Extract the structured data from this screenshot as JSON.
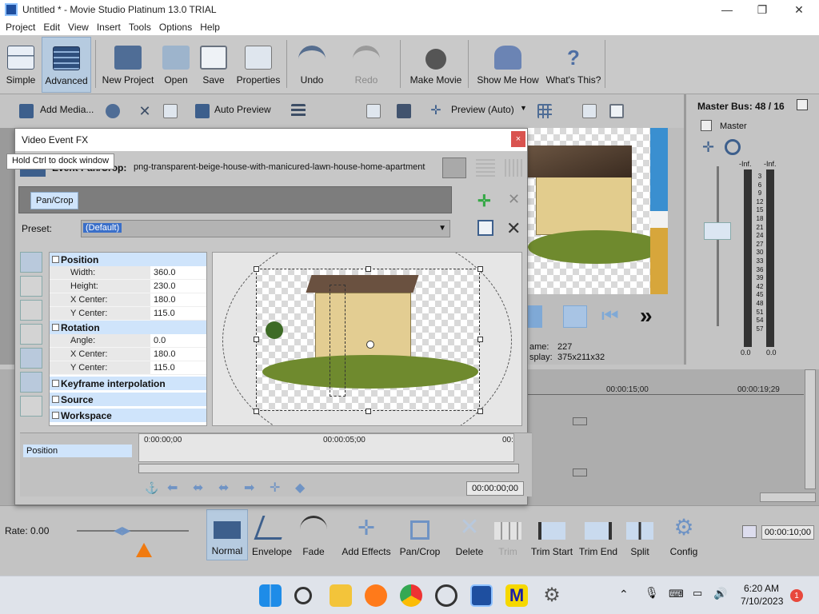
{
  "window": {
    "title": "Untitled * - Movie Studio Platinum 13.0 TRIAL"
  },
  "menu": [
    "Project",
    "Edit",
    "View",
    "Insert",
    "Tools",
    "Options",
    "Help"
  ],
  "toolbar": {
    "simple": "Simple",
    "advanced": "Advanced",
    "new_project": "New Project",
    "open": "Open",
    "save": "Save",
    "properties": "Properties",
    "undo": "Undo",
    "redo": "Redo",
    "make_movie": "Make Movie",
    "show_me_how": "Show Me How",
    "whats_this": "What's This?"
  },
  "secondary_toolbar": {
    "add_media": "Add Media...",
    "auto_preview": "Auto Preview",
    "preview_mode": "Preview (Auto)"
  },
  "mixer": {
    "title": "Master Bus: 48 / 16",
    "channel": "Master",
    "left_label": "-Inf.",
    "right_label": "-Inf.",
    "scale": [
      "3",
      "6",
      "9",
      "12",
      "15",
      "18",
      "21",
      "24",
      "27",
      "30",
      "33",
      "36",
      "39",
      "42",
      "45",
      "48",
      "51",
      "54",
      "57"
    ],
    "left_value": "0.0",
    "right_value": "0.0"
  },
  "preview_info": {
    "frame_label": "ame:",
    "frame_value": "227",
    "display_label": "splay:",
    "display_value": "375x211x32"
  },
  "dialog": {
    "title": "Video Event FX",
    "close": "×",
    "tooltip": "Hold Ctrl to dock window",
    "event_label": "Event Pan/Crop:",
    "event_value": "png-transparent-beige-house-with-manicured-lawn-house-home-apartment",
    "chain_item": "Pan/Crop",
    "preset_label": "Preset:",
    "preset_value": "(Default)",
    "props": {
      "position": {
        "title": "Position",
        "width_label": "Width:",
        "width": "360.0",
        "height_label": "Height:",
        "height": "230.0",
        "xc_label": "X Center:",
        "xc": "180.0",
        "yc_label": "Y Center:",
        "yc": "115.0"
      },
      "rotation": {
        "title": "Rotation",
        "angle_label": "Angle:",
        "angle": "0.0",
        "xc_label": "X Center:",
        "xc": "180.0",
        "yc_label": "Y Center:",
        "yc": "115.0"
      },
      "keyframe": "Keyframe interpolation",
      "source": "Source",
      "workspace": "Workspace"
    },
    "keyframe_track": "Position",
    "ruler": [
      "0:00:00;00",
      "00:00:05;00",
      "00:"
    ],
    "timecode": "00:00:00;00"
  },
  "timeline": {
    "ruler": [
      "00:00:15;00",
      "00:00:19;29"
    ]
  },
  "bottom": {
    "rate": "Rate: 0.00",
    "normal": "Normal",
    "envelope": "Envelope",
    "fade": "Fade",
    "add_effects": "Add Effects",
    "pan_crop": "Pan/Crop",
    "delete": "Delete",
    "trim": "Trim",
    "trim_start": "Trim Start",
    "trim_end": "Trim End",
    "split": "Split",
    "config": "Config",
    "timecode": "00:00:10;00"
  },
  "taskbar": {
    "time": "6:20 AM",
    "date": "7/10/2023",
    "badge": "1"
  }
}
